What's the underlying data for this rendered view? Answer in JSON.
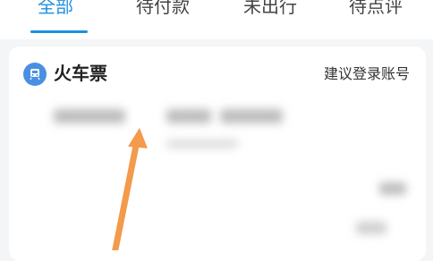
{
  "tabs": [
    {
      "label": "全部",
      "active": true
    },
    {
      "label": "待付款",
      "active": false
    },
    {
      "label": "未出行",
      "active": false
    },
    {
      "label": "待点评",
      "active": false
    }
  ],
  "card": {
    "title": "火车票",
    "login_hint": "建议登录账号",
    "icon": "train-icon"
  },
  "colors": {
    "accent": "#1f8fe0",
    "arrow": "#f39a4c"
  }
}
